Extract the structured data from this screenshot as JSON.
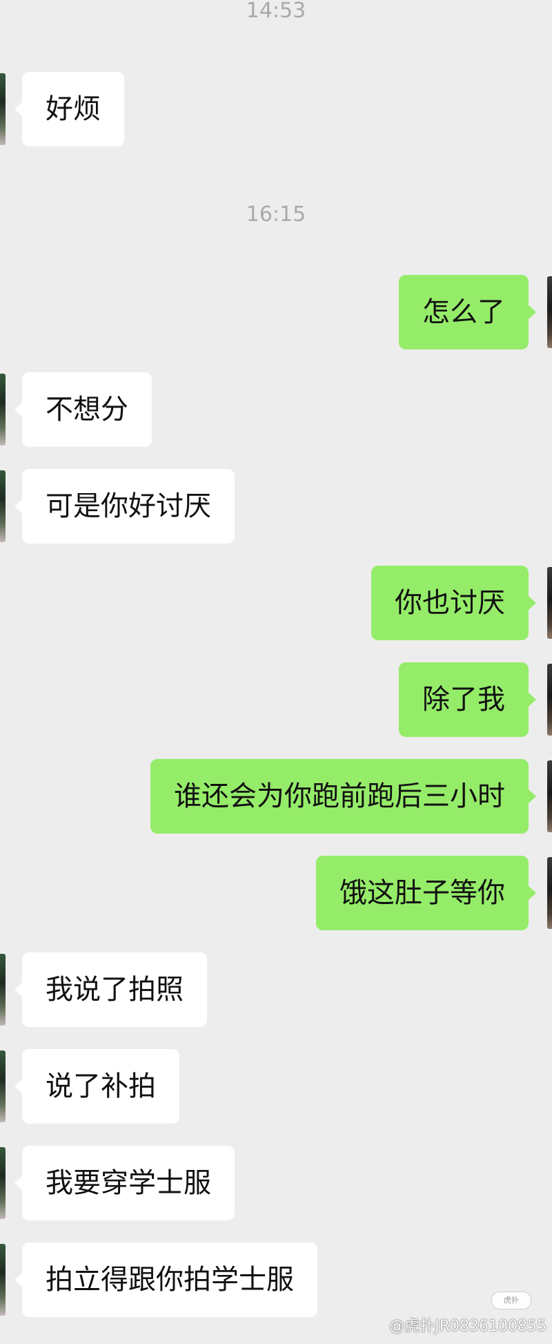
{
  "timestamps": [
    "14:53",
    "16:15"
  ],
  "messages": [
    {
      "side": "left",
      "text": "好烦"
    },
    {
      "side": "right",
      "text": "怎么了"
    },
    {
      "side": "left",
      "text": "不想分"
    },
    {
      "side": "left",
      "text": "可是你好讨厌"
    },
    {
      "side": "right",
      "text": "你也讨厌"
    },
    {
      "side": "right",
      "text": "除了我"
    },
    {
      "side": "right",
      "text": "谁还会为你跑前跑后三小时"
    },
    {
      "side": "right",
      "text": "饿这肚子等你"
    },
    {
      "side": "left",
      "text": "我说了拍照"
    },
    {
      "side": "left",
      "text": "说了补拍"
    },
    {
      "side": "left",
      "text": "我要穿学士服"
    },
    {
      "side": "left",
      "text": "拍立得跟你拍学士服"
    }
  ],
  "watermark": {
    "logo_text": "虎扑",
    "text": "@虎扑JR0836100855"
  },
  "colors": {
    "background": "#EDEDED",
    "bubble_incoming": "#FFFFFF",
    "bubble_outgoing": "#95EC69",
    "timestamp": "#A9A9A9"
  }
}
